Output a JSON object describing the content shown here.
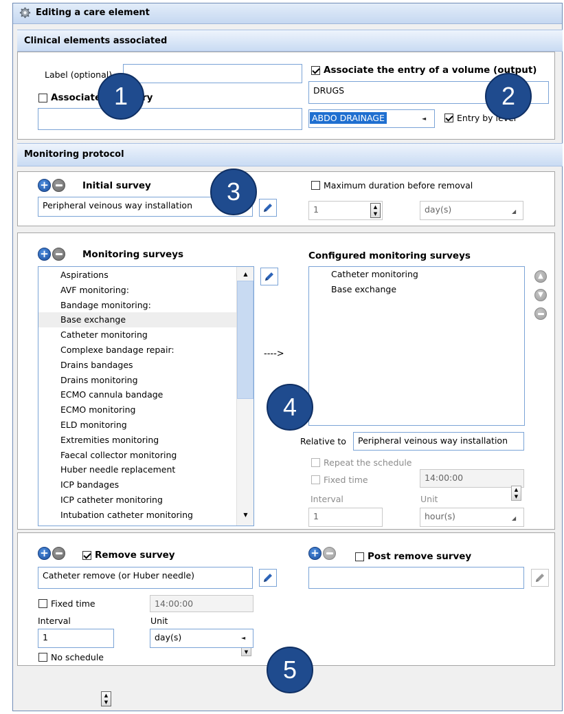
{
  "window": {
    "title": "Editing a care element",
    "icon": "gear-icon"
  },
  "clinical": {
    "header": "Clinical elements associated",
    "label_caption": "Label (optional)",
    "label_value": "",
    "associate_entry_label": "Associate the entry",
    "associate_entry_checked": false,
    "entry_value": "",
    "associate_volume_label": "Associate the entry of a volume (output)",
    "associate_volume_checked": true,
    "volume_value": "DRUGS",
    "drainage_selected": "ABDO DRAINAGE",
    "entry_by_level_label": "Entry by level",
    "entry_by_level_checked": true
  },
  "monitoring": {
    "header": "Monitoring protocol",
    "initial_survey_label": "Initial survey",
    "initial_survey_value": "Peripheral veinous way installation",
    "max_duration_label": "Maximum duration before removal",
    "max_duration_value": "1",
    "max_duration_unit": "day(s)",
    "surveys_label": "Monitoring surveys",
    "surveys": [
      "Aspirations",
      "AVF monitoring:",
      "Bandage monitoring:",
      "Base exchange",
      "Catheter monitoring",
      "Complexe bandage repair:",
      "Drains bandages",
      "Drains monitoring",
      "ECMO cannula bandage",
      "ECMO monitoring",
      "ELD monitoring",
      "Extremities monitoring",
      "Faecal collector monitoring",
      "Huber needle replacement",
      "ICP bandages",
      "ICP catheter monitoring",
      "Intubation catheter monitoring"
    ],
    "arrow_text": "---->",
    "configured_label": "Configured monitoring surveys",
    "configured": [
      "Catheter monitoring",
      "Base exchange"
    ],
    "relative_to_label": "Relative to",
    "relative_to_value": "Peripheral veinous way installation",
    "repeat_label": "Repeat the schedule",
    "fixed_time_label": "Fixed time",
    "fixed_time_value": "14:00:00",
    "interval_label": "Interval",
    "interval_value": "1",
    "unit_label": "Unit",
    "unit_value": "hour(s)"
  },
  "removal": {
    "remove_label": "Remove survey",
    "remove_checked": true,
    "remove_value": "Catheter remove (or Huber needle)",
    "post_remove_label": "Post remove survey",
    "post_remove_checked": false,
    "post_remove_value": "",
    "fixed_time_label": "Fixed time",
    "fixed_time_value": "14:00:00",
    "interval_label": "Interval",
    "interval_value": "1",
    "unit_label": "Unit",
    "unit_value": "day(s)",
    "no_schedule_label": "No schedule"
  },
  "callouts": [
    "1",
    "2",
    "3",
    "4",
    "5"
  ],
  "colors": {
    "accent": "#1f4b8e",
    "header_gradient_top": "#eef4fc",
    "header_gradient_bottom": "#c9dbf3",
    "selection": "#1f6fd0"
  }
}
